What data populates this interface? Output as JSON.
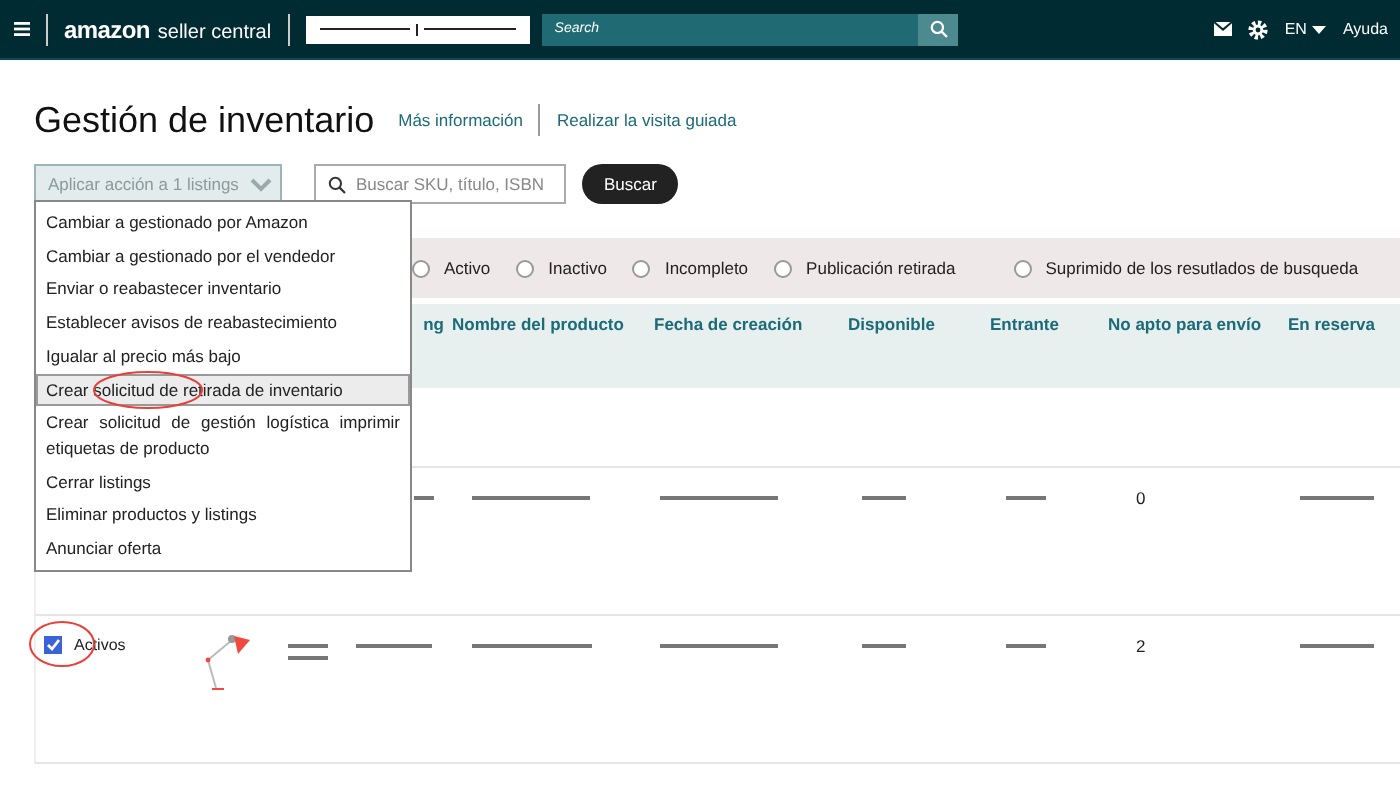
{
  "top_bar": {
    "logo_word": "amazon",
    "logo_sub": "seller central",
    "search_placeholder": "Search",
    "language": "EN",
    "help": "Ayuda"
  },
  "title": "Gestión de inventario",
  "links": [
    "Más información",
    "Realizar la visita guiada"
  ],
  "toolbar": {
    "action_select": "Aplicar acción a 1 listings",
    "search_placeholder": "Buscar SKU, título, ISBN",
    "search_button": "Buscar"
  },
  "action_menu": [
    {
      "label": "Cambiar a gestionado por Amazon",
      "selected": false,
      "circled": false
    },
    {
      "label": "Cambiar a gestionado por el vendedor",
      "selected": false,
      "circled": false
    },
    {
      "label": "Enviar o reabastecer inventario",
      "selected": false,
      "circled": false
    },
    {
      "label": "Establecer avisos de reabastecimiento",
      "selected": false,
      "circled": false
    },
    {
      "label": "Igualar al precio más bajo",
      "selected": false,
      "circled": false
    },
    {
      "label": "Crear solicitud de retirada de inventario",
      "selected": true,
      "circled": true
    },
    {
      "label": "Crear solicitud de gestión logística imprimir etiquetas de producto",
      "selected": false,
      "circled": false
    },
    {
      "label": "Cerrar listings",
      "selected": false,
      "circled": false
    },
    {
      "label": "Eliminar productos y listings",
      "selected": false,
      "circled": false
    },
    {
      "label": "Anunciar oferta",
      "selected": false,
      "circled": false
    }
  ],
  "filters": [
    {
      "label": "Activo",
      "selected": false
    },
    {
      "label": "Inactivo",
      "selected": false
    },
    {
      "label": "Incompleto",
      "selected": false
    },
    {
      "label": "Publicación retirada",
      "selected": false
    },
    {
      "label": "Suprimido de los resutlados de busqueda",
      "selected": false
    }
  ],
  "table": {
    "columns": [
      "ng",
      "Nombre del producto",
      "Fecha de creación",
      "Disponible",
      "Entrante",
      "No apto para envío",
      "En reserva"
    ],
    "rows": [
      {
        "kind": "plain",
        "no_apto": "0"
      },
      {
        "kind": "product",
        "status": "Activos",
        "checked": true,
        "circled": true,
        "no_apto": "2"
      }
    ]
  }
}
